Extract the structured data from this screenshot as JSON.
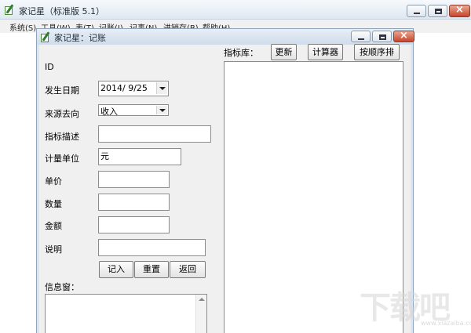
{
  "main_window": {
    "title": "家记星（标准版 5.1）",
    "menu": [
      "系统(S)",
      "工具(W)",
      "表(T)",
      "记账(J)",
      "记事(N)",
      "进销存(B)",
      "帮助(H)"
    ]
  },
  "child_window": {
    "title": "家记星：记账"
  },
  "form": {
    "id_label": "ID",
    "date_label": "发生日期",
    "date_value": "2014/ 9/25",
    "direction_label": "来源去向",
    "direction_value": "收入",
    "indicator_desc_label": "指标描述",
    "indicator_desc_value": "",
    "unit_label": "计量单位",
    "unit_value": "元",
    "price_label": "单价",
    "price_value": "",
    "quantity_label": "数量",
    "quantity_value": "",
    "amount_label": "金额",
    "amount_value": "",
    "note_label": "说明",
    "note_value": "",
    "record_button": "记入",
    "reset_button": "重置",
    "back_button": "返回",
    "info_label": "信息窗：",
    "info_value": ""
  },
  "indicator_panel": {
    "label": "指标库：",
    "refresh_button": "更新",
    "calculator_button": "计算器",
    "sort_button": "按顺序排"
  },
  "watermark": {
    "text": "下载吧",
    "url": "www.xiazaiba.com"
  }
}
